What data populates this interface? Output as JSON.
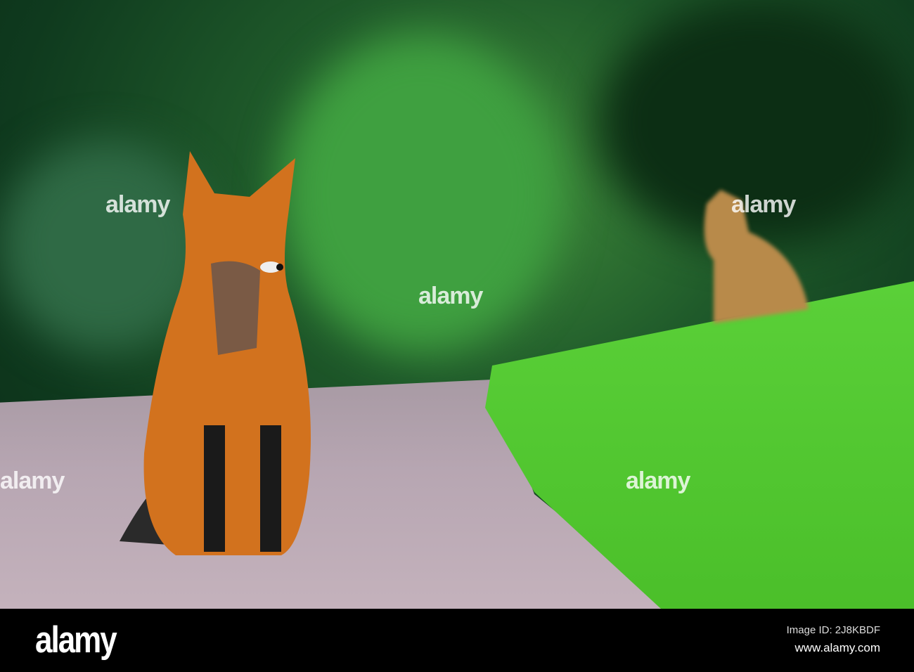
{
  "watermark": {
    "text": "alamy"
  },
  "footer": {
    "logo": "alamy",
    "image_id": "Image ID: 2J8KBDF",
    "url": "www.alamy.com"
  },
  "colors": {
    "fox": "#d2721e",
    "grass": "#5cd23a",
    "forest": "#1f5a2a",
    "path": "#b7a6b2"
  }
}
